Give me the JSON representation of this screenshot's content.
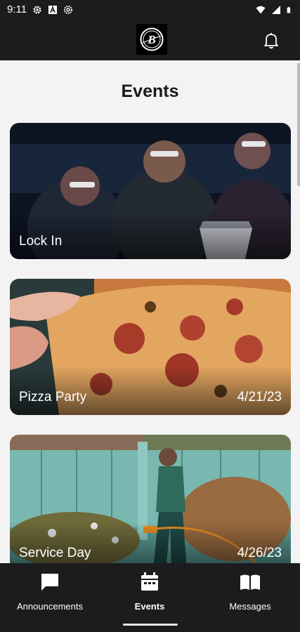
{
  "status_bar": {
    "time": "9:11",
    "left_icons": [
      "gear-icon",
      "a-badge-icon",
      "settings-alt-icon"
    ],
    "right_icons": [
      "wifi-icon",
      "cell-signal-icon",
      "battery-icon"
    ]
  },
  "header": {
    "logo_letter": "B",
    "notification_icon": "bell-icon"
  },
  "page": {
    "title": "Events"
  },
  "events": [
    {
      "name": "Lock In",
      "date": ""
    },
    {
      "name": "Pizza Party",
      "date": "4/21/23"
    },
    {
      "name": "Service Day",
      "date": "4/26/23"
    }
  ],
  "nav": {
    "items": [
      {
        "label": "Announcements",
        "icon": "chat-bubble-icon",
        "active": false
      },
      {
        "label": "Events",
        "icon": "calendar-icon",
        "active": true
      },
      {
        "label": "Messages",
        "icon": "book-icon",
        "active": false
      }
    ]
  },
  "colors": {
    "bar_background": "#1c1c1e",
    "content_background": "#f3f3f3",
    "title_text": "#1a1a1a",
    "nav_text": "#ffffff"
  }
}
